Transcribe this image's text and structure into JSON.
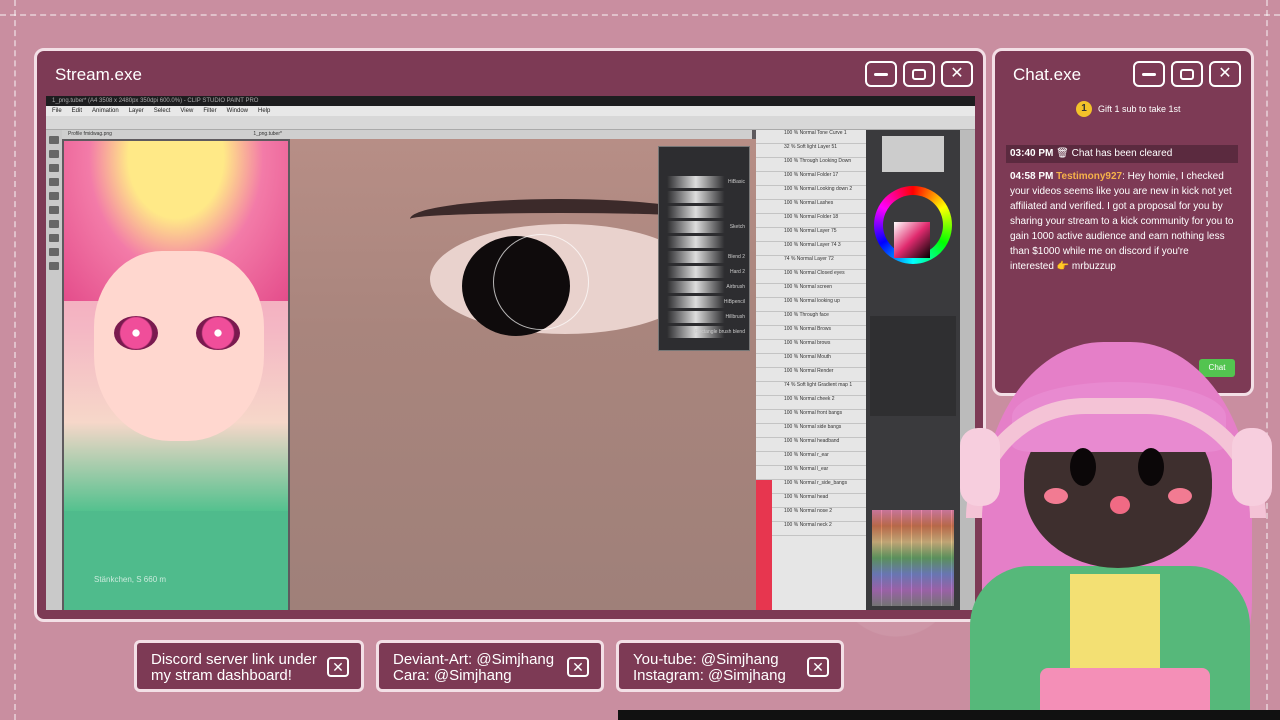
{
  "stream": {
    "title": "Stream.exe",
    "app_title": "1_png.tuber* (A4 3508 x 2480px 350dpi 600.0%) - CLIP STUDIO PAINT PRO",
    "menu": [
      "File",
      "Edit",
      "Animation",
      "Layer",
      "Select",
      "View",
      "Filter",
      "Window",
      "Help"
    ],
    "canvas_tab": "1_png.tuber*",
    "preview_tab": "Profile fmidwag.png",
    "preview_ghost": "Stänkchen, S 660 m",
    "subtool_items": [
      "HiBasic",
      "",
      "",
      "Sketch",
      "",
      "Blend 2",
      "Hard 2",
      "Airbrush",
      "HiBpencil",
      "Hillbrush",
      "Rectangle brush blend"
    ],
    "layers": [
      "100 % Normal Tone Curve 1",
      "32 % Soft light Layer 51",
      "100 % Through Looking Down",
      "100 % Normal Folder 17",
      "100 % Normal Looking down 2",
      "100 % Normal Lashes",
      "100 % Normal Folder 18",
      "100 % Normal Layer 75",
      "100 % Normal Layer 74 3",
      "74 % Normal Layer 72",
      "100 % Normal Closed eyes",
      "100 % Normal screen",
      "100 % Normal looking up",
      "100 % Through face",
      "100 % Normal Brows",
      "100 % Normal brows",
      "100 % Normal Mouth",
      "100 % Normal Render",
      "74 % Soft light Gradient map 1",
      "100 % Normal cheek 2",
      "100 % Normal front bangs",
      "100 % Normal side bangs",
      "100 % Normal headband",
      "100 % Normal r_ear",
      "100 % Normal l_ear",
      "100 % Normal r_side_bangs",
      "100 % Normal head",
      "100 % Normal nose 2",
      "100 % Normal neck 2"
    ]
  },
  "chat": {
    "title": "Chat.exe",
    "pinned": {
      "badge": "1",
      "text": "Gift 1 sub to take 1st"
    },
    "system": {
      "time": "03:40 PM",
      "text": "Chat has been cleared"
    },
    "message": {
      "time": "04:58 PM",
      "user": "Testimony927",
      "text": ": Hey homie, I checked your videos seems like you are new in kick not yet affiliated and verified. I got a proposal for you by sharing your stream to a kick community for you to gain 1000 active audience and earn nothing less than $1000 while me on discord if you're interested 👉 mrbuzzup"
    },
    "chat_button": "Chat"
  },
  "pills": [
    {
      "line1": "Discord server link under",
      "line2": "my stram dashboard!"
    },
    {
      "line1": "Deviant-Art: @Simjhang",
      "line2": "Cara: @Simjhang"
    },
    {
      "line1": "You-tube: @Simjhang",
      "line2": "Instagram: @Simjhang"
    }
  ],
  "icons": {
    "minimize": "minimize-icon",
    "maximize": "maximize-icon",
    "close": "close-icon"
  },
  "colors": {
    "window": "#7d3a55",
    "border": "#f3dfe6",
    "background": "#c98ea0",
    "username": "#f6b24a"
  }
}
